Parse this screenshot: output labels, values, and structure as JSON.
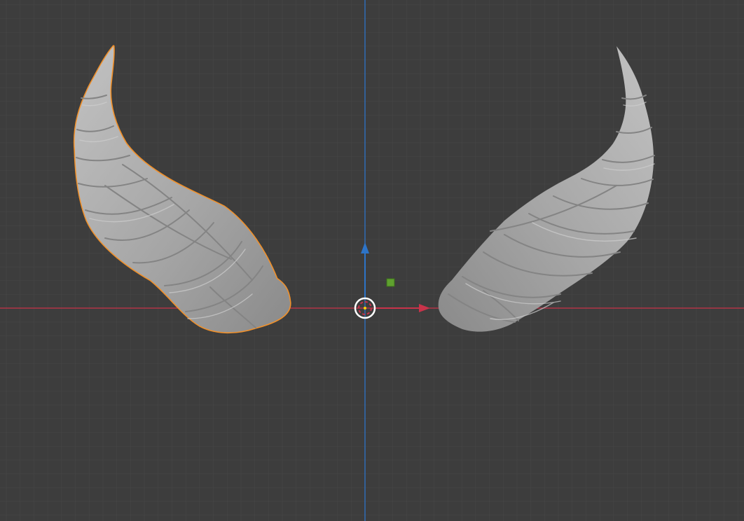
{
  "viewport": {
    "background": "#3d3d3d",
    "grid_minor_color": "#474747",
    "grid_major_color": "#4f4f4f",
    "x_axis_color": "#c8334a",
    "z_axis_color": "#2d74c8",
    "selection_outline_color": "#f0902a",
    "mesh_color": "#a9a9a9",
    "mesh_shadow_color": "#7a7a7a",
    "mesh_highlight_color": "#c6c6c6",
    "light_marker_color": "#5fa12f",
    "cursor_color": "#ffffff"
  },
  "objects": [
    {
      "name": "horn-left",
      "selected": true
    },
    {
      "name": "horn-right",
      "selected": false
    }
  ],
  "gizmo": {
    "x_arrow_icon": "arrow-right-icon",
    "z_arrow_icon": "arrow-up-icon",
    "cursor_icon": "3d-cursor-icon",
    "light_icon": "light-marker-icon"
  }
}
